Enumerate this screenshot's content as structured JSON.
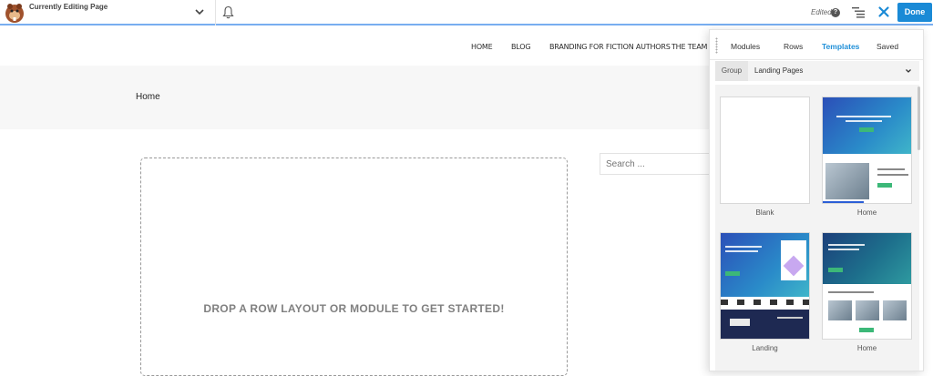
{
  "topbar": {
    "editing_label": "Currently Editing Page",
    "edited_label": "Edited",
    "help_label": "?",
    "done_label": "Done",
    "icons": [
      "beaver-logo-icon",
      "chevron-down-icon",
      "bell-icon",
      "help-icon",
      "outline-list-icon",
      "close-icon"
    ],
    "accent": "#1a8ad6"
  },
  "nav": {
    "items": [
      "HOME",
      "BLOG",
      "BRANDING FOR FICTION AUTHORS",
      "THE TEAM"
    ]
  },
  "page": {
    "breadcrumb": "Home",
    "drop_text": "DROP A ROW LAYOUT OR MODULE TO GET STARTED!",
    "search_placeholder": "Search ..."
  },
  "panel": {
    "tabs": [
      "Modules",
      "Rows",
      "Templates",
      "Saved"
    ],
    "active_tab": "Templates",
    "group_label": "Group",
    "group_value": "Landing Pages",
    "templates": [
      {
        "name": "Blank"
      },
      {
        "name": "Home"
      },
      {
        "name": "Landing"
      },
      {
        "name": "Home"
      }
    ],
    "hero_colors": [
      "#2b4fb8",
      "#1c3f7a"
    ],
    "button_color": "#3cb878"
  }
}
